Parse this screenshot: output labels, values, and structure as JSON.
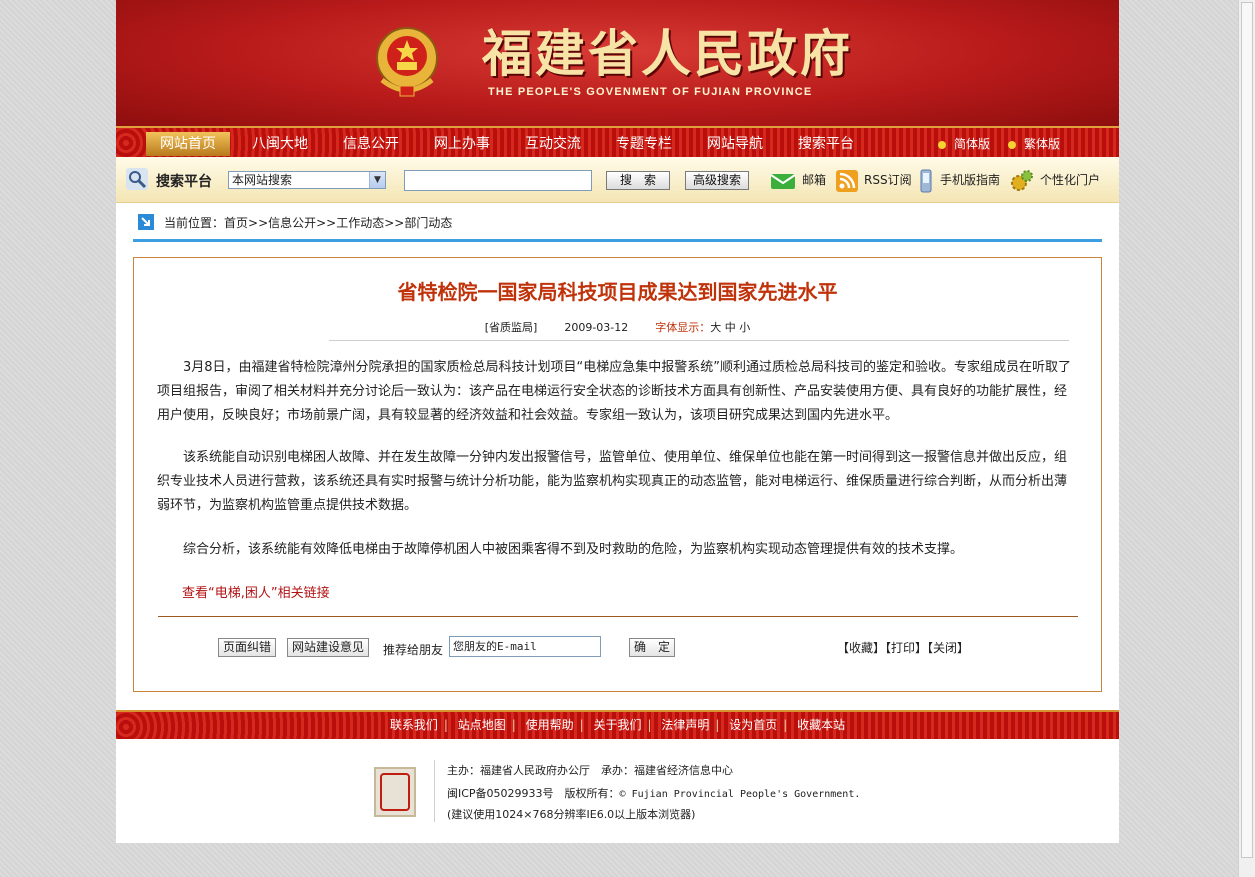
{
  "header": {
    "title": "福建省人民政府",
    "subtitle": "THE PEOPLE'S GOVENMENT OF FUJIAN PROVINCE"
  },
  "nav": {
    "items": [
      "网站首页",
      "八闽大地",
      "信息公开",
      "网上办事",
      "互动交流",
      "专题专栏",
      "网站导航",
      "搜索平台"
    ],
    "active": "网站首页",
    "lang_simplified": "简体版",
    "lang_traditional": "繁体版"
  },
  "search": {
    "label": "搜索平台",
    "scope": "本网站搜索",
    "query": "",
    "search_button": "搜　索",
    "advanced_button": "高级搜索",
    "tools": [
      "邮箱",
      "RSS订阅",
      "手机版指南",
      "个性化门户"
    ]
  },
  "breadcrumb": {
    "label": "当前位置：",
    "path": "首页>>信息公开>>工作动态>>部门动态"
  },
  "article": {
    "title": "省特检院一国家局科技项目成果达到国家先进水平",
    "source": "[省质监局]",
    "date": "2009-03-12",
    "font_label": "字体显示：",
    "font_sizes": [
      "大",
      "中",
      "小"
    ],
    "paragraphs": [
      "3月8日，由福建省特检院漳州分院承担的国家质检总局科技计划项目“电梯应急集中报警系统”顺利通过质检总局科技司的鉴定和验收。专家组成员在听取了项目组报告，审阅了相关材料并充分讨论后一致认为：该产品在电梯运行安全状态的诊断技术方面具有创新性、产品安装使用方便、具有良好的功能扩展性，经用户使用，反映良好；市场前景广阔，具有较显著的经济效益和社会效益。专家组一致认为，该项目研究成果达到国内先进水平。",
      "该系统能自动识别电梯困人故障、并在发生故障一分钟内发出报警信号，监管单位、使用单位、维保单位也能在第一时间得到这一报警信息并做出反应，组织专业技术人员进行营救，该系统还具有实时报警与统计分析功能，能为监察机构实现真正的动态监管，能对电梯运行、维保质量进行综合判断，从而分析出薄弱环节，为监察机构监管重点提供技术数据。",
      "综合分析，该系统能有效降低电梯由于故障停机困人中被困乘客得不到及时救助的危险，为监察机构实现动态管理提供有效的技术支撑。"
    ],
    "related_link": "查看“电梯,困人”相关链接",
    "error_button": "页面纠错",
    "feedback_button": "网站建设意见",
    "recommend_label": "推荐给朋友",
    "email_value": "您朋友的E-mail",
    "confirm_button": "确　定",
    "actions": "【收藏】【打印】【关闭】"
  },
  "footer": {
    "links": [
      "联系我们",
      "站点地图",
      "使用帮助",
      "关于我们",
      "法律声明",
      "设为首页",
      "收藏本站"
    ],
    "host": "主办：福建省人民政府办公厅　承办：福建省经济信息中心",
    "icp": "闽ICP备05029933号　版权所有：",
    "copyright_en": "© Fujian Provincial People's Government.",
    "browser_note": "(建议使用1024×768分辨率IE6.0以上版本浏览器)"
  },
  "colors": {
    "banner_red": "#b81a1a",
    "title_gold": "#f7e3a5",
    "article_title": "#c0320a",
    "link_blue_rule": "#3c9ee0"
  }
}
